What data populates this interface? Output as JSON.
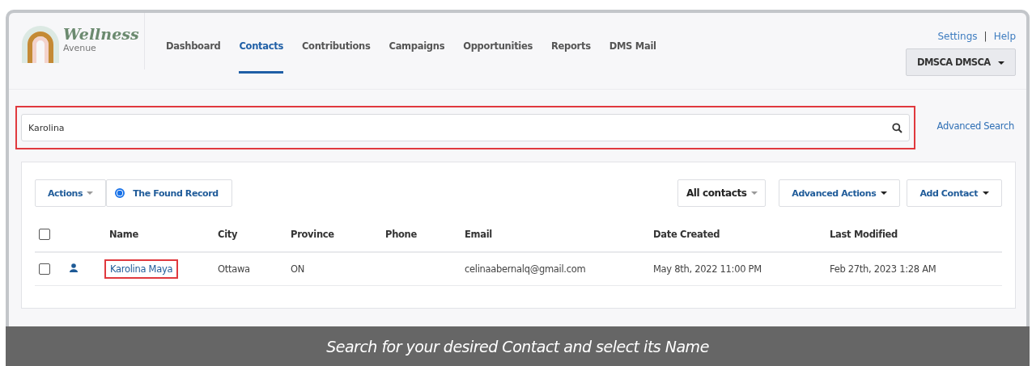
{
  "logo": {
    "title": "Wellness",
    "subtitle": "Avenue"
  },
  "nav": [
    {
      "label": "Dashboard",
      "selected": false
    },
    {
      "label": "Contacts",
      "selected": true
    },
    {
      "label": "Contributions",
      "selected": false
    },
    {
      "label": "Campaigns",
      "selected": false
    },
    {
      "label": "Opportunities",
      "selected": false
    },
    {
      "label": "Reports",
      "selected": false
    },
    {
      "label": "DMS Mail",
      "selected": false
    }
  ],
  "top_links": {
    "settings": "Settings",
    "separator": "|",
    "help": "Help"
  },
  "user_menu": "DMSCA DMSCA",
  "search": {
    "value": "Karolina",
    "highlighted": true
  },
  "advanced_search": "Advanced Search",
  "toolbar": {
    "actions": "Actions",
    "found_record": {
      "label": "The Found Record",
      "selected": true
    },
    "filter": "All contacts",
    "advanced_actions": "Advanced Actions",
    "add_contact": "Add Contact"
  },
  "table": {
    "select_all_checked": false,
    "columns": [
      "Name",
      "City",
      "Province",
      "Phone",
      "Email",
      "Date Created",
      "Last Modified"
    ],
    "rows": [
      {
        "checked": false,
        "name": "Karolina Maya",
        "name_highlighted": true,
        "city": "Ottawa",
        "province": "ON",
        "email": "celinaabernalq@gmail.com",
        "created": "May 8th, 2022 11:00 PM",
        "modified": "Feb 27th, 2023 1:28 AM"
      }
    ]
  },
  "caption": "Search for your desired Contact and select its Name"
}
